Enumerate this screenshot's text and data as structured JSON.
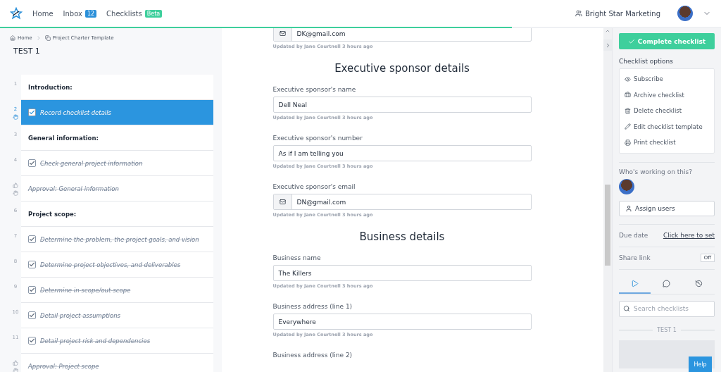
{
  "nav": {
    "links": [
      {
        "label": "Home",
        "kind": "plain"
      },
      {
        "label": "Inbox",
        "kind": "count",
        "badge": "12"
      },
      {
        "label": "Checklists",
        "kind": "tag",
        "badge": "Beta"
      }
    ],
    "org": "Bright Star Marketing",
    "progress": {
      "level": 0.71
    }
  },
  "breadcrumb": [
    "Home",
    "Project Charter Template"
  ],
  "title": "TEST 1",
  "items": [
    {
      "number": "1",
      "kind": "heading",
      "label": "Introduction:",
      "selected": false
    },
    {
      "number": "2",
      "kind": "task",
      "label": "Record checklist details",
      "checked": true,
      "selected": true
    },
    {
      "number": "3",
      "kind": "heading",
      "label": "General information:",
      "selected": false
    },
    {
      "number": "4",
      "kind": "task",
      "label": "Check general project information",
      "checked": true,
      "selected": false
    },
    {
      "kind": "approval",
      "label": "Approval: General information",
      "selected": false
    },
    {
      "number": "6",
      "kind": "heading",
      "label": "Project scope:",
      "selected": false
    },
    {
      "number": "7",
      "kind": "task",
      "label": "Determine the problem, the project goals, and vision",
      "checked": true,
      "selected": false
    },
    {
      "number": "8",
      "kind": "task",
      "label": "Determine project objectives, and deliverables",
      "checked": true,
      "selected": false
    },
    {
      "number": "9",
      "kind": "task",
      "label": "Determine in-scope/out-scope",
      "checked": true,
      "selected": false
    },
    {
      "number": "10",
      "kind": "task",
      "label": "Detail project assumptions",
      "checked": true,
      "selected": false
    },
    {
      "number": "11",
      "kind": "task",
      "label": "Detail project risk and dependencies",
      "checked": true,
      "selected": false
    },
    {
      "kind": "approval",
      "label": "Approval: Project scope",
      "selected": false
    }
  ],
  "form": [
    {
      "kind": "email",
      "value": "DK@gmail.com",
      "updated": "Updated by Jane Courtnell 3 hours ago"
    },
    {
      "kind": "heading",
      "text": "Executive sponsor details"
    },
    {
      "kind": "text",
      "label": "Executive sponsor's name",
      "value": "Dell Neal",
      "updated": "Updated by Jane Courtnell 3 hours ago"
    },
    {
      "kind": "text",
      "label": "Executive sponsor's number",
      "value": "As if I am telling you",
      "updated": "Updated by Jane Courtnell 3 hours ago"
    },
    {
      "kind": "email",
      "label": "Executive sponsor's email",
      "value": "DN@gmail.com",
      "updated": "Updated by Jane Courtnell 3 hours ago"
    },
    {
      "kind": "heading",
      "text": "Business details"
    },
    {
      "kind": "text",
      "label": "Business name",
      "value": "The Killers",
      "updated": "Updated by Jane Courtnell 3 hours ago"
    },
    {
      "kind": "text",
      "label": "Business address (line 1)",
      "value": "Everywhere",
      "updated": "Updated by Jane Courtnell 3 hours ago"
    },
    {
      "kind": "label",
      "label": "Business address (line 2)"
    }
  ],
  "sidebar": {
    "complete": "Complete checklist",
    "options_title": "Checklist options",
    "options": [
      {
        "kind": "eye",
        "label": "Subscribe"
      },
      {
        "kind": "archive",
        "label": "Archive checklist"
      },
      {
        "kind": "trash",
        "label": "Delete checklist"
      },
      {
        "kind": "pencil",
        "label": "Edit checklist template"
      },
      {
        "kind": "printer",
        "label": "Print checklist"
      }
    ],
    "working_title": "Who's working on this?",
    "assign": "Assign users",
    "due_label": "Due date",
    "due_link": "Click here to set",
    "share_label": "Share link",
    "share_toggle": {
      "label": "Off",
      "on": false
    },
    "tabs": [
      {
        "kind": "play",
        "selected": true
      },
      {
        "kind": "comment",
        "selected": false
      },
      {
        "kind": "history",
        "selected": false
      }
    ],
    "search_placeholder": "Search checklists",
    "group": "TEST 1"
  },
  "help": "Help"
}
